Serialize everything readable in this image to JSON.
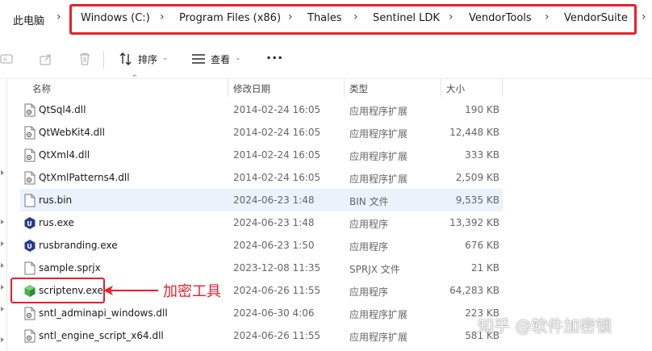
{
  "breadcrumb": {
    "root": "此电脑",
    "segments": [
      "Windows (C:)",
      "Program Files (x86)",
      "Thales",
      "Sentinel LDK",
      "VendorTools",
      "VendorSuite"
    ]
  },
  "toolbar": {
    "sort_label": "排序",
    "view_label": "查看",
    "more_label": "···"
  },
  "columns": {
    "name": "名称",
    "date": "修改日期",
    "type": "类型",
    "size": "大小"
  },
  "files": [
    {
      "name": "QtSql4.dll",
      "date": "2014-02-24 16:05",
      "type": "应用程序扩展",
      "size": "190 KB",
      "icon": "dll-file-icon"
    },
    {
      "name": "QtWebKit4.dll",
      "date": "2014-02-24 16:05",
      "type": "应用程序扩展",
      "size": "12,448 KB",
      "icon": "dll-file-icon"
    },
    {
      "name": "QtXml4.dll",
      "date": "2014-02-24 16:05",
      "type": "应用程序扩展",
      "size": "333 KB",
      "icon": "dll-file-icon"
    },
    {
      "name": "QtXmlPatterns4.dll",
      "date": "2014-02-24 16:05",
      "type": "应用程序扩展",
      "size": "2,509 KB",
      "icon": "dll-file-icon"
    },
    {
      "name": "rus.bin",
      "date": "2024-06-23 1:48",
      "type": "BIN 文件",
      "size": "9,535 KB",
      "icon": "blank-file-icon"
    },
    {
      "name": "rus.exe",
      "date": "2024-06-23 1:48",
      "type": "应用程序",
      "size": "13,392 KB",
      "icon": "rus-app-icon"
    },
    {
      "name": "rusbranding.exe",
      "date": "2024-06-23 1:50",
      "type": "应用程序",
      "size": "676 KB",
      "icon": "rus-app-icon"
    },
    {
      "name": "sample.sprjx",
      "date": "2023-12-08 11:35",
      "type": "SPRJX 文件",
      "size": "21 KB",
      "icon": "blank-file-icon"
    },
    {
      "name": "scriptenv.exe",
      "date": "2024-06-26 11:55",
      "type": "应用程序",
      "size": "64,283 KB",
      "icon": "green-cube-icon"
    },
    {
      "name": "sntl_adminapi_windows.dll",
      "date": "2024-06-30 4:06",
      "type": "应用程序扩展",
      "size": "223 KB",
      "icon": "dll-file-icon"
    },
    {
      "name": "sntl_engine_script_x64.dll",
      "date": "2024-06-26 11:55",
      "type": "应用程序扩展",
      "size": "581 KB",
      "icon": "dll-file-icon"
    }
  ],
  "annotation": {
    "label": "加密工具",
    "color": "#e8202a"
  },
  "watermark": "知乎 @软件加密锁",
  "colors": {
    "highlight": "#e8202a",
    "row_hover": "#eaf2fc",
    "rus_icon": "#2b3a8c",
    "cube_icon": "#4caf50"
  }
}
